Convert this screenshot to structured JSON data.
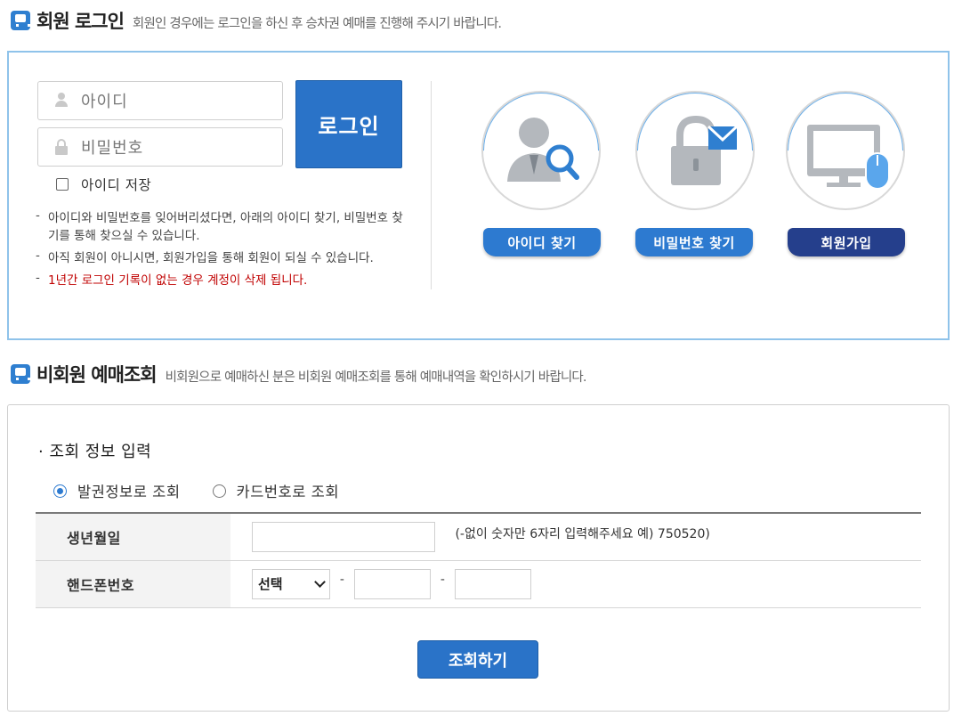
{
  "member_login": {
    "title": "회원 로그인",
    "description": "회원인 경우에는 로그인을 하신 후 승차권 예매를 진행해 주시기 바랍니다.",
    "id_placeholder": "아이디",
    "password_placeholder": "비밀번호",
    "login_button": "로그인",
    "save_id_label": "아이디 저장",
    "save_id_checked": false,
    "notes": [
      "아이디와 비밀번호를 잊어버리셨다면, 아래의 아이디 찾기, 비밀번호 찾기를 통해 찾으실 수 있습니다.",
      "아직 회원이 아니시면, 회원가입을 통해 회원이 되실 수 있습니다.",
      "1년간 로그인 기록이 없는 경우 계정이 삭제 됩니다."
    ],
    "actions": [
      {
        "label": "아이디 찾기",
        "icon": "person-search-icon"
      },
      {
        "label": "비밀번호 찾기",
        "icon": "lock-mail-icon"
      },
      {
        "label": "회원가입",
        "icon": "monitor-mouse-icon"
      }
    ],
    "colors": {
      "accent": "#2a73c8",
      "border": "#8fc3ea",
      "signup": "#253f8c",
      "warning": "#c00000"
    }
  },
  "non_member": {
    "title": "비회원 예매조회",
    "description": "비회원으로 예매하신 분은 비회원 예매조회를 통해 예매내역을 확인하시기 바랍니다.",
    "section_title": "· 조회 정보 입력",
    "radio_options": [
      {
        "label": "발권정보로 조회",
        "selected": true
      },
      {
        "label": "카드번호로 조회",
        "selected": false
      }
    ],
    "rows": {
      "birth_label": "생년월일",
      "birth_value": "",
      "birth_hint": "(-없이 숫자만 6자리 입력해주세요 예) 750520)",
      "phone_label": "핸드폰번호",
      "phone_prefix_selected": "선택",
      "phone_middle": "",
      "phone_last": "",
      "separator": "-"
    },
    "search_button": "조회하기"
  }
}
